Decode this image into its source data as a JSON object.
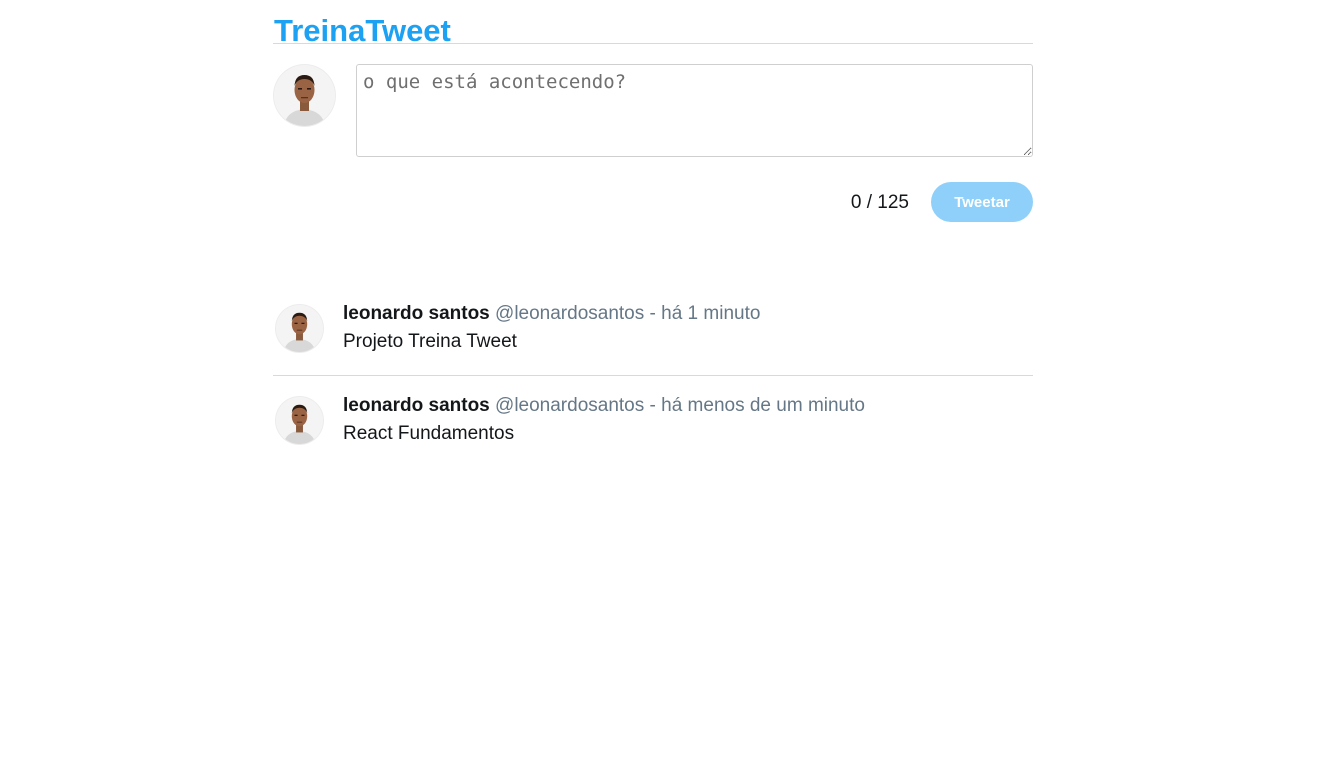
{
  "app": {
    "title": "TreinaTweet"
  },
  "compose": {
    "placeholder": "o que está acontecendo?",
    "value": "",
    "counter": "0 / 125",
    "submit_label": "Tweetar"
  },
  "tweets": [
    {
      "name": "leonardo santos",
      "handle": "@leonardosantos",
      "separator": "-",
      "time": "há 1 minuto",
      "text": "Projeto Treina Tweet"
    },
    {
      "name": "leonardo santos",
      "handle": "@leonardosantos",
      "separator": "-",
      "time": "há menos de um minuto",
      "text": "React Fundamentos"
    }
  ],
  "colors": {
    "brand": "#1da1f2",
    "button_disabled": "#8ed0f9",
    "muted_text": "#657786"
  }
}
